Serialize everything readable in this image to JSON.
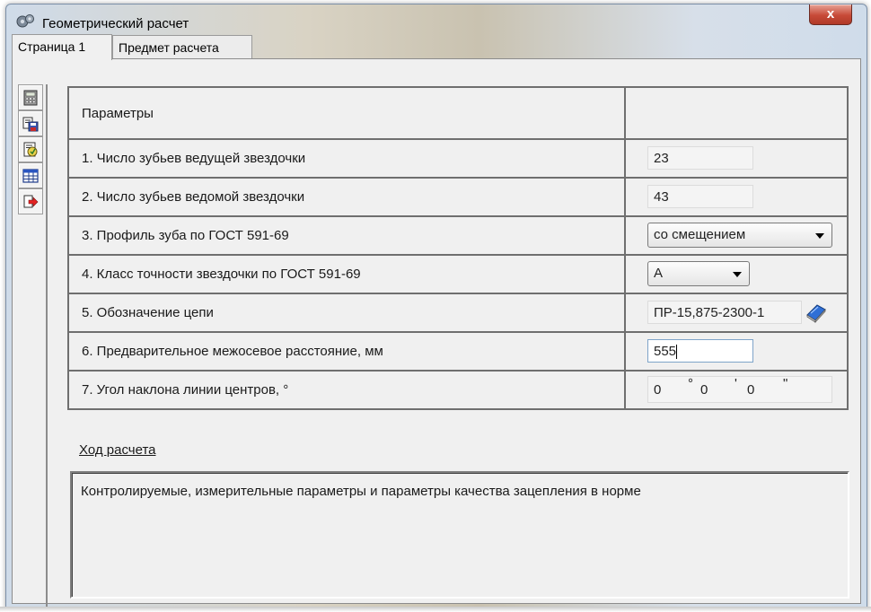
{
  "window": {
    "title": "Геометрический расчет",
    "close_label": "x"
  },
  "tabs": [
    {
      "label": "Страница 1",
      "active": true
    },
    {
      "label": "Предмет расчета",
      "active": false
    }
  ],
  "toolbar": [
    "calculator-icon",
    "save-icon",
    "report-icon",
    "table-icon",
    "exit-icon"
  ],
  "grid": {
    "header": "Параметры",
    "rows": [
      {
        "label": "1. Число зубьев ведущей звездочки",
        "value": "23"
      },
      {
        "label": "2. Число зубьев ведомой звездочки",
        "value": "43"
      },
      {
        "label": "3. Профиль зуба по ГОСТ 591-69",
        "value": "со смещением"
      },
      {
        "label": "4. Класс точности звездочки по ГОСТ 591-69",
        "value": "А"
      },
      {
        "label": "5. Обозначение цепи",
        "value": "ПР-15,875-2300-1"
      },
      {
        "label": "6. Предварительное межосевое расстояние, мм",
        "value": "555"
      },
      {
        "label": "7. Угол наклона линии центров, °",
        "deg": "0",
        "deg_sym": "°",
        "min": "0",
        "min_sym": "'",
        "sec": "0",
        "sec_sym": "\""
      }
    ]
  },
  "progress_link": "Ход расчета",
  "result_text": "Контролируемые, измерительные параметры и параметры качества зацепления в норме"
}
